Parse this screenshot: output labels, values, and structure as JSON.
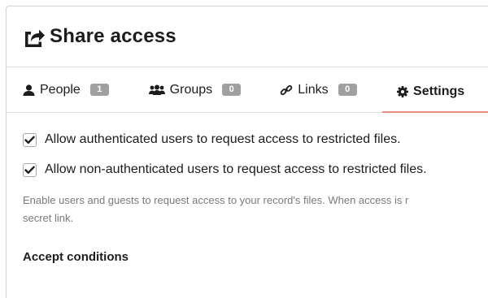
{
  "header": {
    "title": "Share access",
    "icon": "share-square-icon"
  },
  "tabs": [
    {
      "label": "People",
      "count": "1",
      "icon": "user-icon"
    },
    {
      "label": "Groups",
      "count": "0",
      "icon": "users-icon"
    },
    {
      "label": "Links",
      "count": "0",
      "icon": "link-icon"
    },
    {
      "label": "Settings",
      "icon": "cog-icon",
      "active": true
    }
  ],
  "settings": {
    "option_authenticated": {
      "label": "Allow authenticated users to request access to restricted files.",
      "checked": true
    },
    "option_guests": {
      "label": "Allow non-authenticated users to request access to restricted files.",
      "checked": true
    },
    "help_text": "Enable users and guests to request access to your record's files. When access is r",
    "help_text_line2": "secret link.",
    "accept_conditions_title": "Accept conditions"
  },
  "colors": {
    "active_tab_underline": "#e98f7e",
    "badge": "#a0a0a0"
  }
}
